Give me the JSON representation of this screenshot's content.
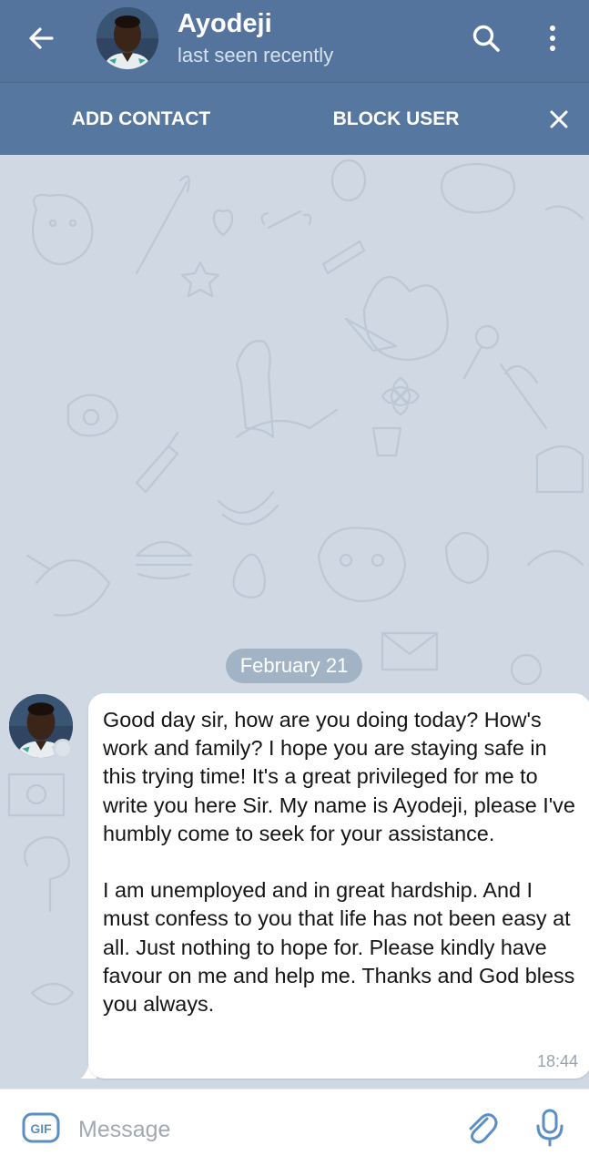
{
  "header": {
    "contact_name": "Ayodeji",
    "status": "last seen recently",
    "color": "#54749d"
  },
  "actionbar": {
    "add_contact_label": "ADD CONTACT",
    "block_user_label": "BLOCK USER"
  },
  "chat": {
    "date_label": "February 21",
    "background_color": "#cfd8e3",
    "message": {
      "paragraph_1": "Good day sir, how are you doing today? How's work and family? I hope you are staying safe in this trying time! It's a great privileged for me to write you here Sir. My name is Ayodeji, please I've humbly come to seek for your assistance.",
      "paragraph_2": "I am unemployed and in great hardship. And I must confess to you that life has not been easy at all. Just nothing to hope for. Please kindly have favour on me and help me. Thanks and God bless you always.",
      "time": "18:44"
    }
  },
  "composer": {
    "gif_label": "GIF",
    "placeholder": "Message"
  },
  "icons": {
    "back": "arrow-left",
    "search": "magnifier",
    "menu": "three-dots-vertical",
    "close": "x",
    "attach": "paperclip",
    "mic": "microphone"
  }
}
